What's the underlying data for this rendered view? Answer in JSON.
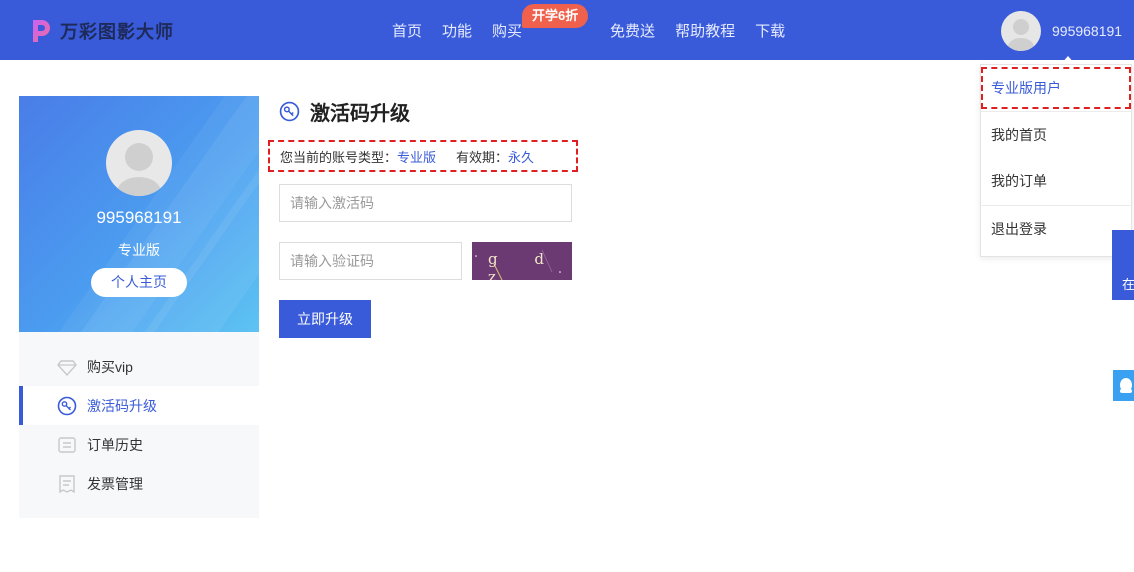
{
  "header": {
    "logo_text": "万彩图影大师",
    "nav": [
      {
        "label": "首页"
      },
      {
        "label": "功能"
      },
      {
        "label": "购买"
      },
      {
        "label": "免费送"
      },
      {
        "label": "帮助教程"
      },
      {
        "label": "下载"
      }
    ],
    "promo_badge": "开学6折",
    "user_name": "995968191"
  },
  "dropdown": {
    "items": [
      {
        "label": "专业版用户"
      },
      {
        "label": "我的首页"
      },
      {
        "label": "我的订单"
      },
      {
        "label": "退出登录"
      }
    ]
  },
  "float": {
    "online_label": "在"
  },
  "profile": {
    "name": "995968191",
    "level": "专业版",
    "home_button": "个人主页"
  },
  "side_menu": {
    "items": [
      {
        "label": "购买vip",
        "icon": "diamond-icon"
      },
      {
        "label": "激活码升级",
        "icon": "activation-icon",
        "active": true
      },
      {
        "label": "订单历史",
        "icon": "list-icon"
      },
      {
        "label": "发票管理",
        "icon": "invoice-icon"
      }
    ]
  },
  "main": {
    "title": "激活码升级",
    "account_type_label": "您当前的账号类型：",
    "account_type_value": "专业版",
    "validity_label": "有效期：",
    "validity_value": "永久",
    "activation_placeholder": "请输入激活码",
    "captcha_placeholder": "请输入验证码",
    "captcha_text": "g d z",
    "upgrade_button": "立即升级"
  },
  "colors": {
    "primary": "#3a5bd9",
    "promo": "#f0614d",
    "highlight_border": "#e02020"
  }
}
